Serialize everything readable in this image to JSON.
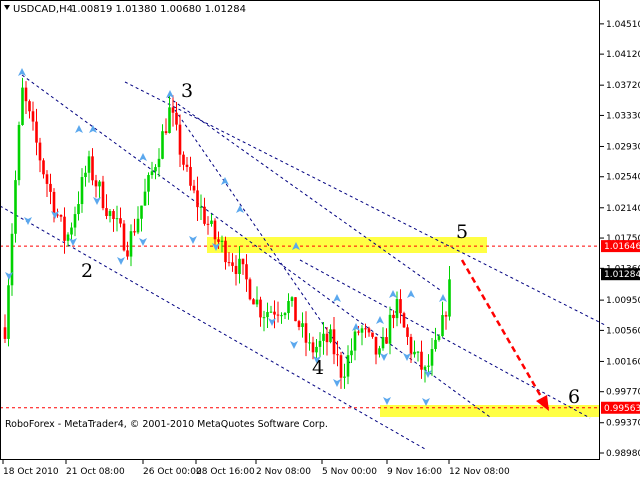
{
  "header": {
    "symbol": "USDCAD,H4",
    "ohlc": "1.00819 1.01380 1.00680 1.01284"
  },
  "footer": {
    "copyright": "RoboForex - MetaTrader4, © 2001-2010 MetaQuotes Software Corp."
  },
  "colors": {
    "bull": "#00d200",
    "bear": "#ff0000",
    "channel": "#000080",
    "arrow": "#5ba8ee",
    "level": "#ff0000",
    "highlight": "#ffff44",
    "forecast": "#ff0000"
  },
  "chart_data": {
    "type": "candlestick",
    "ylim": [
      0.9898,
      1.0465
    ],
    "y_ticks": [
      "1.04510",
      "1.04120",
      "1.03720",
      "1.03330",
      "1.02930",
      "1.02540",
      "1.02140",
      "1.01750",
      "1.01360",
      "1.00950",
      "1.00560",
      "1.00160",
      "0.99770",
      "0.99370",
      "0.98980"
    ],
    "x_ticks": [
      "18 Oct 2010",
      "21 Oct 08:00",
      "26 Oct 00:00",
      "28 Oct 16:00",
      "2 Nov 08:00",
      "5 Nov 00:00",
      "9 Nov 16:00",
      "12 Nov 08:00"
    ],
    "price_labels": [
      {
        "value": 1.01646,
        "text": "1.01646",
        "role": "resistance"
      },
      {
        "value": 1.01284,
        "text": "1.01284",
        "role": "current"
      },
      {
        "value": 0.99563,
        "text": "0.99563",
        "role": "target"
      }
    ],
    "wave_labels": [
      "2",
      "3",
      "4",
      "5",
      "6"
    ]
  }
}
